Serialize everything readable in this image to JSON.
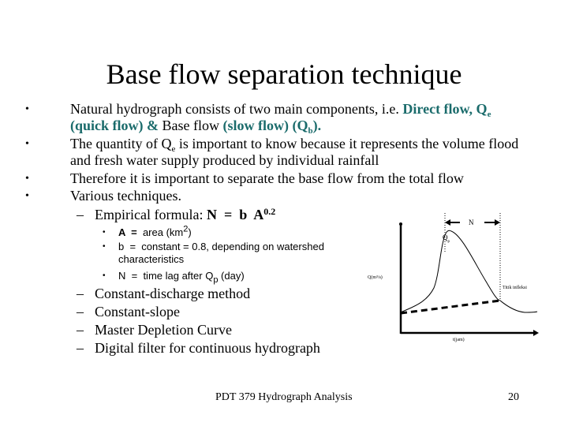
{
  "slide": {
    "title": "Base flow separation technique",
    "bullets": [
      {
        "text_1": "Natural hydrograph consists of two main components, i.e. ",
        "direct_flow": "Direct flow, Q",
        "direct_flow_sub": "e",
        "line2_teal_1": "(quick flow) & ",
        "line2_plain": "Base flow ",
        "line2_teal_2": "(slow flow) (Q",
        "line2_teal_sub": "b",
        "line2_end": ")."
      },
      {
        "text_1": "The quantity of Q",
        "sub": "e",
        "text_2": " is important to know because it represents the volume flood",
        "line2": "and fresh water supply produced by individual rainfall"
      },
      {
        "text": "Therefore it is important to separate the base flow from the total flow"
      },
      {
        "text": "Various techniques."
      }
    ],
    "bullet_char": "•",
    "dash_char": "–",
    "formula": {
      "label": "Empirical formula: ",
      "expr": "N  =  b  A",
      "exponent": "0.2"
    },
    "formula_items": [
      {
        "sym": "A  =  ",
        "text": "area (km",
        "sup": "2",
        "end": ")"
      },
      {
        "sym": "b  =  ",
        "text": "constant =  0.8, depending on watershed",
        "line2": "characteristics"
      },
      {
        "sym": "N  =  ",
        "text": "time lag after Q",
        "sub": "p",
        "end": " (day)"
      }
    ],
    "methods": [
      "Constant-discharge method",
      "Constant-slope",
      "Master Depletion Curve",
      "Digital filter for continuous hydrograph"
    ],
    "diagram": {
      "n_label": "N",
      "peak_label": "Q",
      "peak_sub": "p",
      "y_label": "Q(m³/s)",
      "x_label": "t(jam)",
      "inflection_label": "Titik infleksi"
    },
    "footer": {
      "course": "PDT 379 Hydrograph Analysis",
      "page": "20"
    }
  }
}
